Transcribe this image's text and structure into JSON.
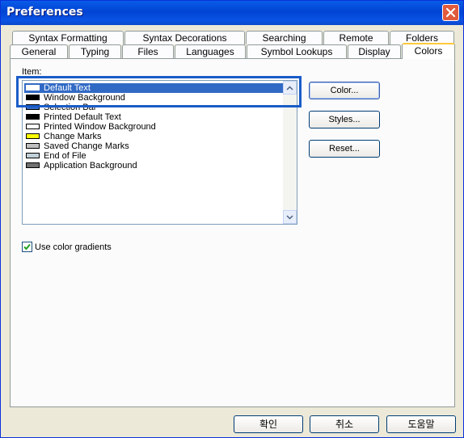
{
  "window": {
    "title": "Preferences"
  },
  "tabs": {
    "row1": [
      "Syntax Formatting",
      "Syntax Decorations",
      "Searching",
      "Remote",
      "Folders"
    ],
    "row2": [
      "General",
      "Typing",
      "Files",
      "Languages",
      "Symbol Lookups",
      "Display",
      "Colors"
    ],
    "active": "Colors"
  },
  "item_label": "Item:",
  "items": [
    {
      "label": "Default Text",
      "color": "#ffffff",
      "selected": true
    },
    {
      "label": "Window Background",
      "color": "#000000",
      "selected": false
    },
    {
      "label": "Selection Bar",
      "color": "#316ac5",
      "selected": false
    },
    {
      "label": "Printed Default Text",
      "color": "#000000",
      "selected": false
    },
    {
      "label": "Printed Window Background",
      "color": "#ffffff",
      "selected": false
    },
    {
      "label": "Change Marks",
      "color": "#ffff00",
      "selected": false
    },
    {
      "label": "Saved Change Marks",
      "color": "#c0c0c0",
      "selected": false
    },
    {
      "label": "End of File",
      "color": "#c0d0d8",
      "selected": false
    },
    {
      "label": "Application Background",
      "color": "#707070",
      "selected": false
    }
  ],
  "buttons": {
    "color": "Color...",
    "styles": "Styles...",
    "reset": "Reset..."
  },
  "checkbox": {
    "label": "Use color gradients",
    "checked": true
  },
  "footer": {
    "ok": "확인",
    "cancel": "취소",
    "help": "도움말"
  }
}
